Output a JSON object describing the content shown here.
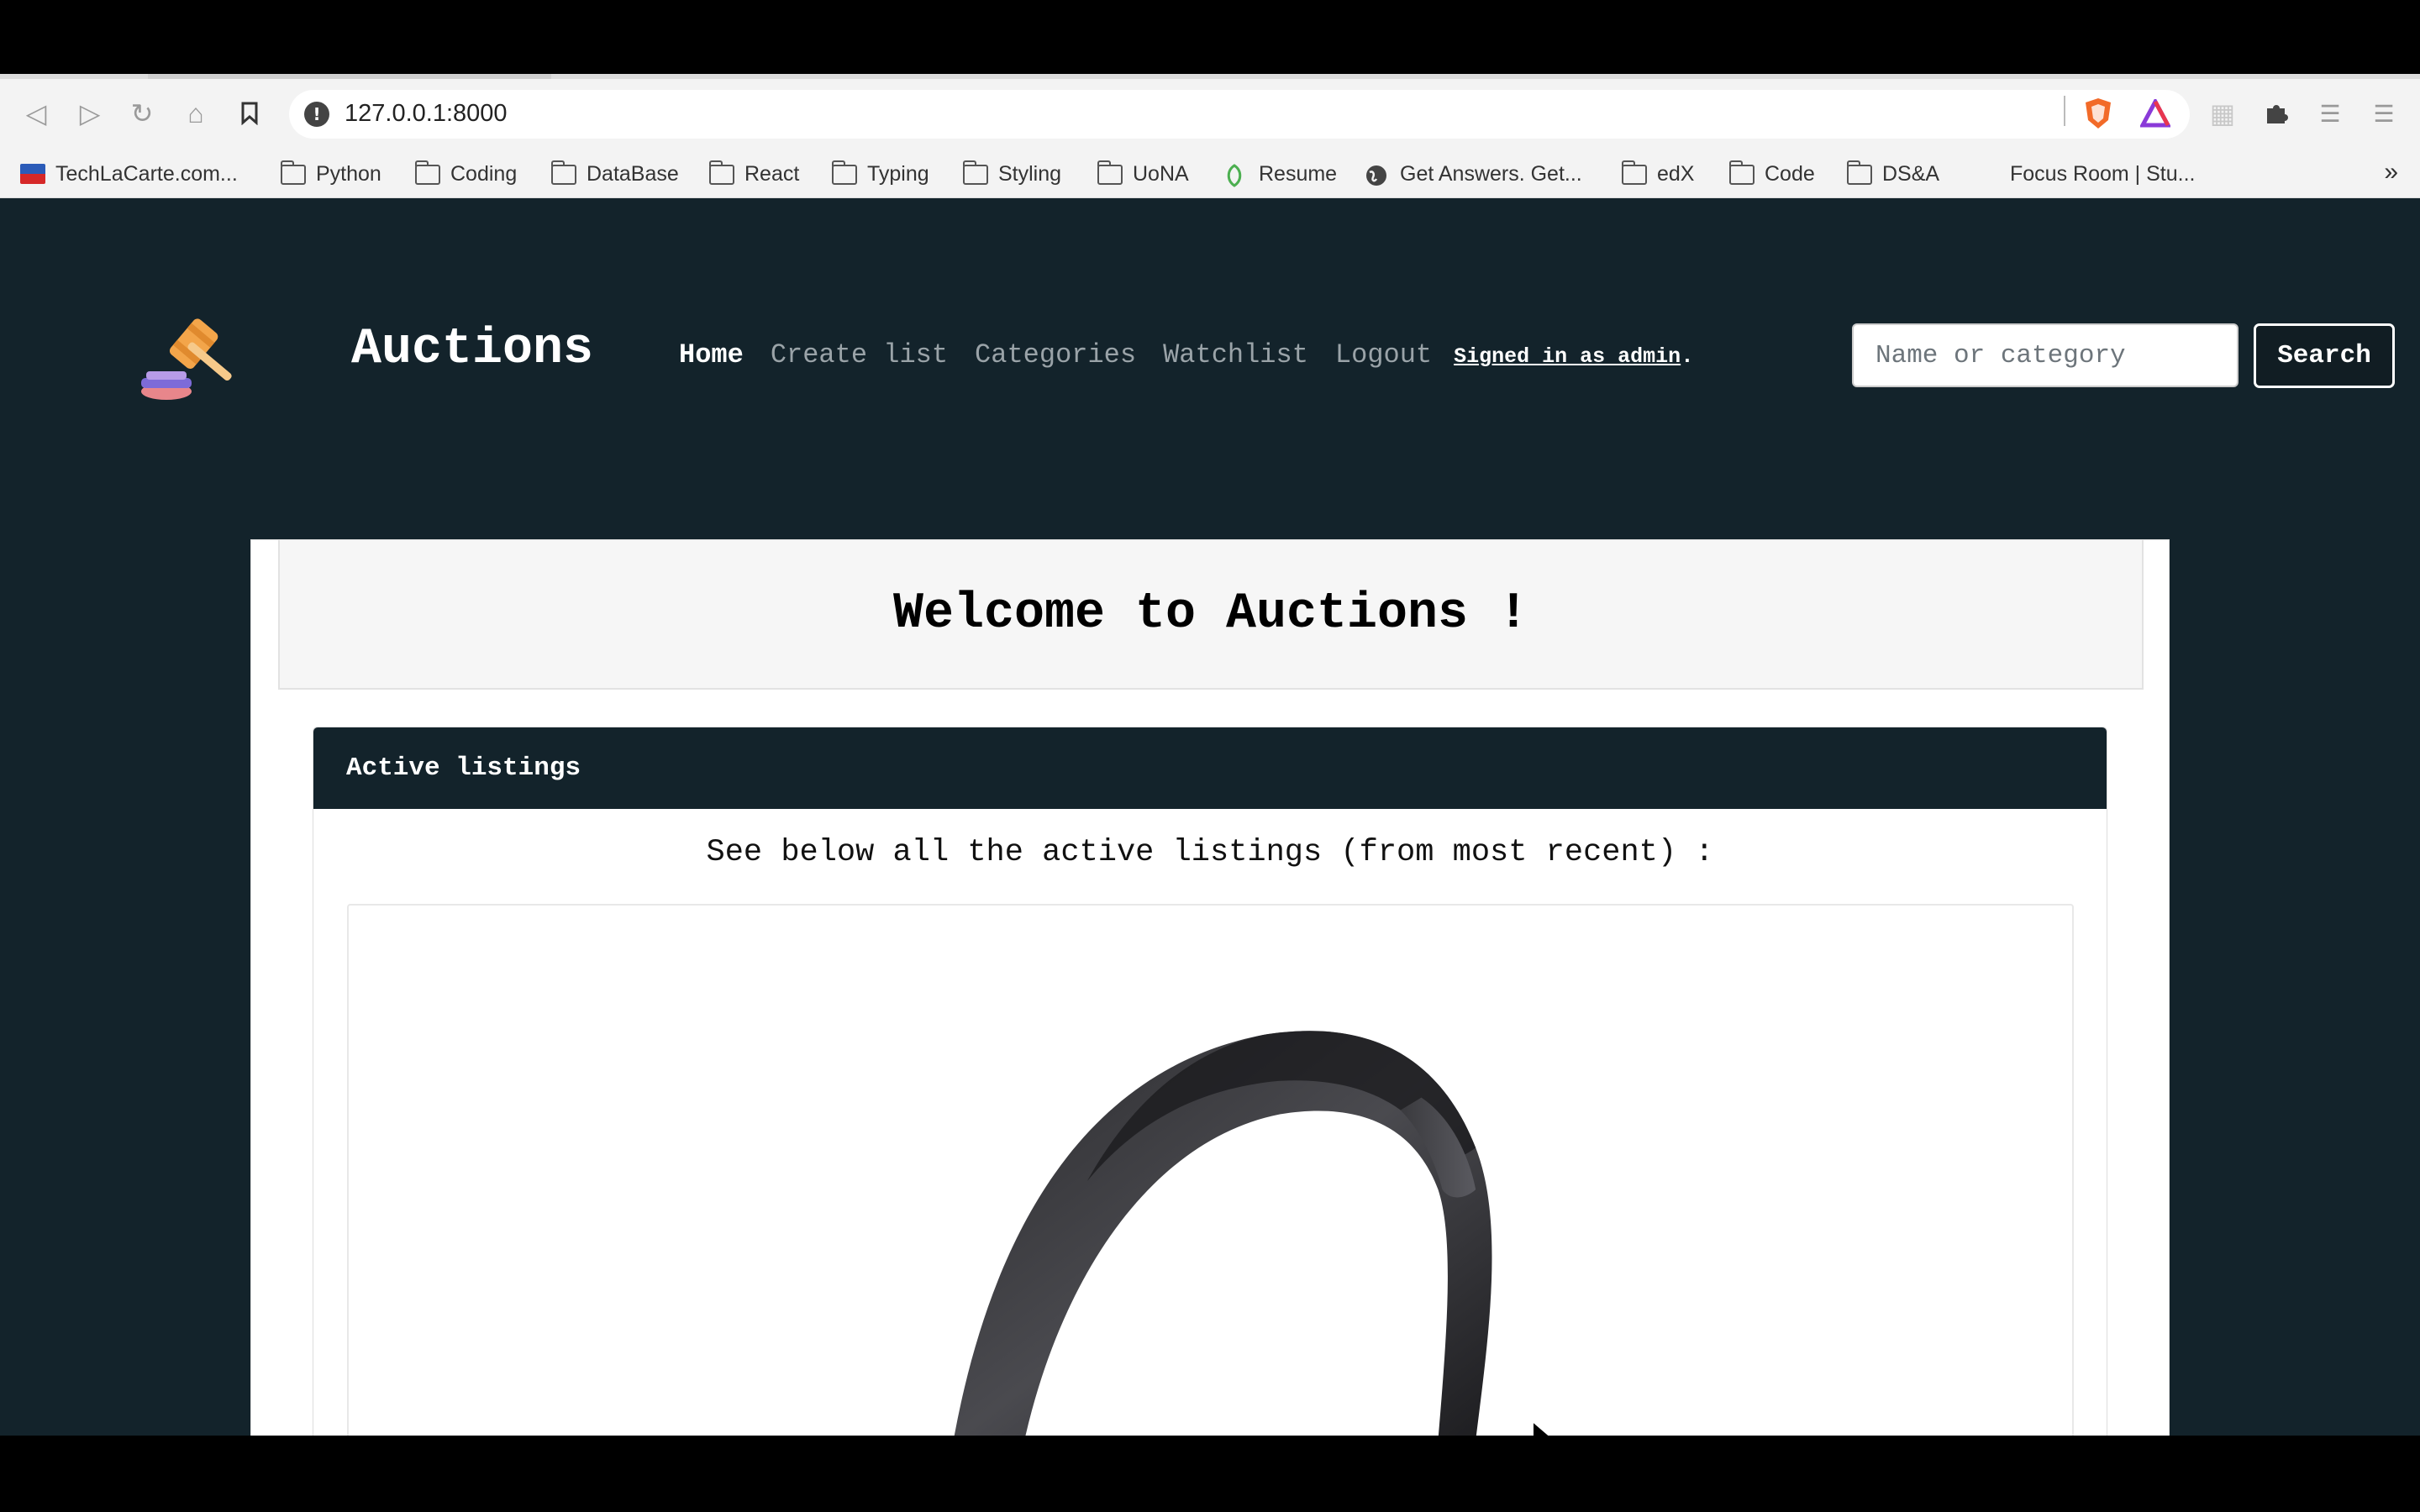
{
  "browser": {
    "url": "127.0.0.1:8000",
    "bookmarks": [
      {
        "label": "TechLaCarte.com...",
        "icon": "flag-icon"
      },
      {
        "label": "Python",
        "icon": "folder-icon"
      },
      {
        "label": "Coding",
        "icon": "folder-icon"
      },
      {
        "label": "DataBase",
        "icon": "folder-icon"
      },
      {
        "label": "React",
        "icon": "folder-icon"
      },
      {
        "label": "Typing",
        "icon": "folder-icon"
      },
      {
        "label": "Styling",
        "icon": "folder-icon"
      },
      {
        "label": "UoNA",
        "icon": "folder-icon"
      },
      {
        "label": "Resume",
        "icon": "leaf-icon"
      },
      {
        "label": "Get Answers. Get...",
        "icon": "globe-icon"
      },
      {
        "label": "edX",
        "icon": "folder-icon"
      },
      {
        "label": "Code",
        "icon": "folder-icon"
      },
      {
        "label": "DS&A",
        "icon": "folder-icon"
      },
      {
        "label": "Focus Room | Stu...",
        "icon": "none"
      }
    ],
    "more_label": "»"
  },
  "site": {
    "brand": "Auctions",
    "nav": {
      "home": "Home",
      "create": "Create list",
      "categories": "Categories",
      "watchlist": "Watchlist",
      "logout": "Logout"
    },
    "signed_in": "Signed in as admin",
    "signed_in_suffix": ".",
    "search": {
      "placeholder": "Name or category",
      "button": "Search"
    }
  },
  "main": {
    "welcome": "Welcome to Auctions !",
    "listings_header": "Active listings",
    "listings_intro": "See below all the active listings (from most recent) :"
  },
  "colors": {
    "page_background": "#13232b",
    "header_background": "#13232b",
    "card_background": "#ffffff",
    "welcome_background": "#f6f6f6"
  }
}
